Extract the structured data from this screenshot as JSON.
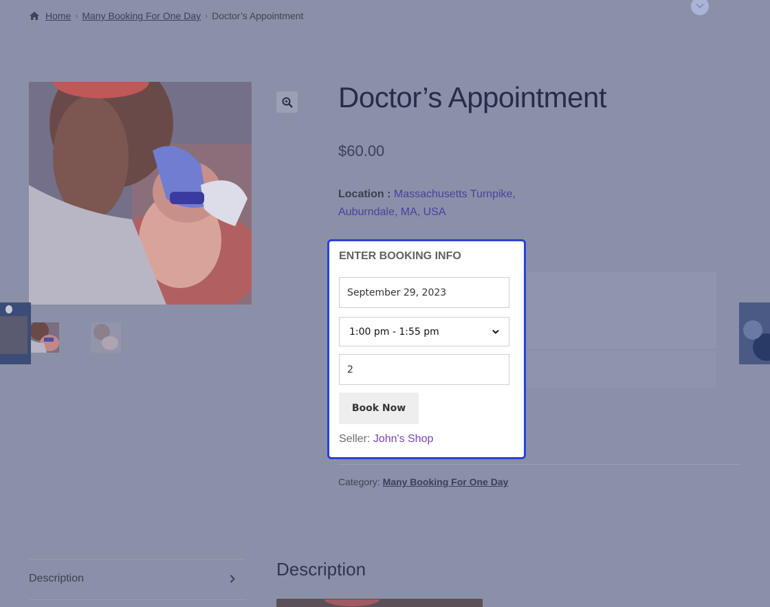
{
  "breadcrumb": {
    "home": "Home",
    "category": "Many Booking For One Day",
    "current": "Doctor’s Appointment"
  },
  "product": {
    "title": "Doctor’s Appointment",
    "price": "$60.00",
    "location_label": "Location :",
    "location_value": "Massachusetts Turnpike, Auburndale, MA, USA"
  },
  "booking": {
    "heading": "ENTER BOOKING INFO",
    "date_value": "September 29, 2023",
    "time_slot": "1:00 pm - 1:55 pm",
    "quantity": "2",
    "book_button": "Book Now",
    "seller_label": "Seller:",
    "seller_name": "John's Shop"
  },
  "meta": {
    "category_label": "Category:",
    "category_value": "Many Booking For One Day"
  },
  "tabs": {
    "description_tab": "Description",
    "description_heading": "Description"
  },
  "colors": {
    "overlay": "#8a90a8",
    "card_border": "#2a40d8",
    "seller_link": "#7a40b8"
  }
}
